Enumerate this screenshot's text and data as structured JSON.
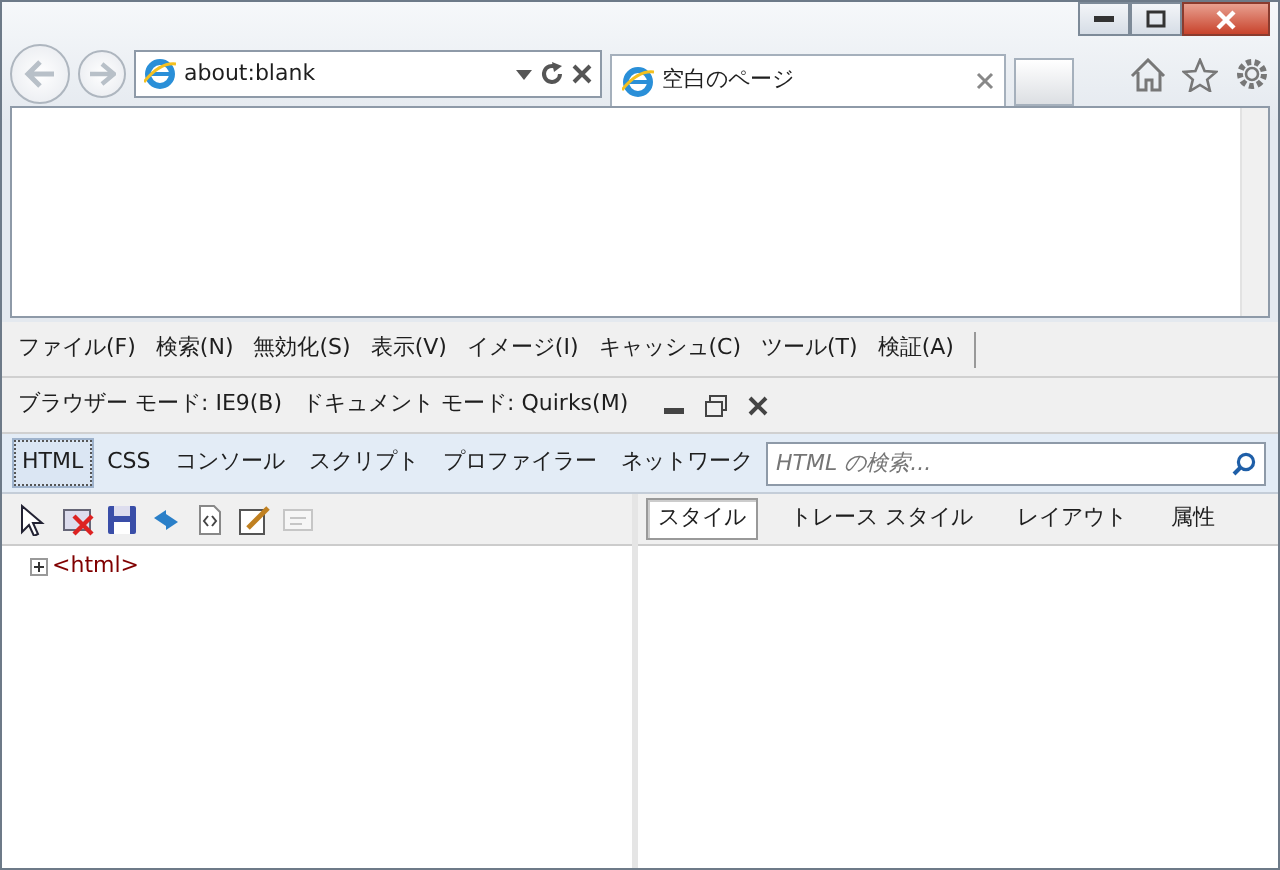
{
  "address_bar": {
    "value": "about:blank"
  },
  "tabs": [
    {
      "label": "空白のページ",
      "selected": true
    }
  ],
  "menu": [
    "ファイル(F)",
    "検索(N)",
    "無効化(S)",
    "表示(V)",
    "イメージ(I)",
    "キャッシュ(C)",
    "ツール(T)",
    "検証(A)"
  ],
  "mode_bar": {
    "browser_mode": "ブラウザー モード: IE9(B)",
    "document_mode": "ドキュメント モード:  Quirks(M)"
  },
  "devtools_tabs": [
    {
      "label": "HTML",
      "selected": true
    },
    {
      "label": "CSS",
      "selected": false
    },
    {
      "label": "コンソール",
      "selected": false
    },
    {
      "label": "スクリプト",
      "selected": false
    },
    {
      "label": "プロファイラー",
      "selected": false
    },
    {
      "label": "ネットワーク",
      "selected": false
    }
  ],
  "search": {
    "placeholder": "HTML の検索..."
  },
  "toolbar": [
    {
      "disabled": false
    },
    {
      "disabled": false
    },
    {
      "disabled": false
    },
    {
      "disabled": false
    },
    {
      "disabled": false
    },
    {
      "disabled": false
    },
    {
      "disabled": true
    }
  ],
  "style_tabs": [
    {
      "label": "スタイル",
      "selected": true
    },
    {
      "label": "トレース スタイル",
      "selected": false
    },
    {
      "label": "レイアウト",
      "selected": false
    },
    {
      "label": "属性",
      "selected": false
    }
  ],
  "tree": [
    {
      "label": "<html>",
      "expanded": false
    }
  ]
}
